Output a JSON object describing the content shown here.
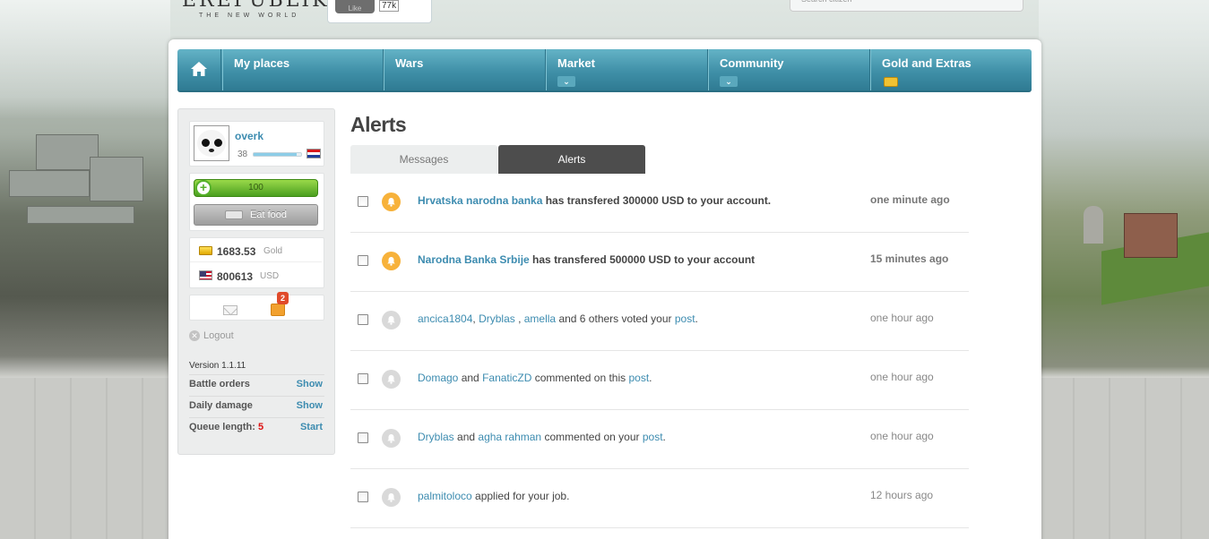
{
  "header": {
    "logo": "EREPUBLIK",
    "logo_sub": "THE NEW WORLD",
    "like_label": "Like",
    "like_count": "77k",
    "search_placeholder": "Search citizen"
  },
  "nav": {
    "items": [
      {
        "label": "My places"
      },
      {
        "label": "Wars"
      },
      {
        "label": "Market"
      },
      {
        "label": "Community"
      },
      {
        "label": "Gold and Extras"
      }
    ]
  },
  "sidebar": {
    "username": "overk",
    "level": "38",
    "xp_fraction": 0.9,
    "health": "100",
    "health_fraction": 1.0,
    "eat_food": "Eat food",
    "gold_amount": "1683.53",
    "gold_label": "Gold",
    "usd_amount": "800613",
    "usd_label": "USD",
    "alerts_badge": "2",
    "logout": "Logout",
    "version": "Version 1.1.11",
    "options": [
      {
        "label": "Battle orders",
        "action": "Show"
      },
      {
        "label": "Daily damage",
        "action": "Show"
      },
      {
        "label": "Queue length:",
        "value": "5",
        "action": "Start"
      }
    ]
  },
  "main": {
    "title": "Alerts",
    "tabs": [
      {
        "label": "Messages"
      },
      {
        "label": "Alerts"
      }
    ],
    "alerts": [
      {
        "parts": [
          {
            "t": "Hrvatska narodna banka",
            "link": true
          },
          {
            "t": " has transfered 300000 USD to your account."
          }
        ],
        "time": "one minute ago",
        "unread": true
      },
      {
        "parts": [
          {
            "t": "Narodna Banka Srbije",
            "link": true
          },
          {
            "t": " has transfered 500000 USD to your account"
          }
        ],
        "time": "15 minutes ago",
        "unread": true
      },
      {
        "parts": [
          {
            "t": "ancica1804",
            "link": true
          },
          {
            "t": ", "
          },
          {
            "t": "Dryblas ",
            "link": true
          },
          {
            "t": ", "
          },
          {
            "t": "amella",
            "link": true
          },
          {
            "t": " and 6 others voted your "
          },
          {
            "t": "post",
            "link": true
          },
          {
            "t": "."
          }
        ],
        "time": "one hour ago",
        "unread": false
      },
      {
        "parts": [
          {
            "t": "Domago",
            "link": true
          },
          {
            "t": " and "
          },
          {
            "t": "FanaticZD",
            "link": true
          },
          {
            "t": " commented on this "
          },
          {
            "t": "post",
            "link": true
          },
          {
            "t": "."
          }
        ],
        "time": "one hour ago",
        "unread": false
      },
      {
        "parts": [
          {
            "t": "Dryblas",
            "link": true
          },
          {
            "t": " and "
          },
          {
            "t": "agha rahman",
            "link": true
          },
          {
            "t": " commented on your "
          },
          {
            "t": "post",
            "link": true
          },
          {
            "t": "."
          }
        ],
        "time": "one hour ago",
        "unread": false
      },
      {
        "parts": [
          {
            "t": "palmitoloco",
            "link": true
          },
          {
            "t": " applied for your job."
          }
        ],
        "time": "12 hours ago",
        "unread": false
      }
    ]
  },
  "colors": {
    "nav_blue": "#3f8fa7",
    "link_blue": "#3d8cb0",
    "alert_orange": "#f7b23b",
    "tab_active": "#4d4d4d"
  }
}
